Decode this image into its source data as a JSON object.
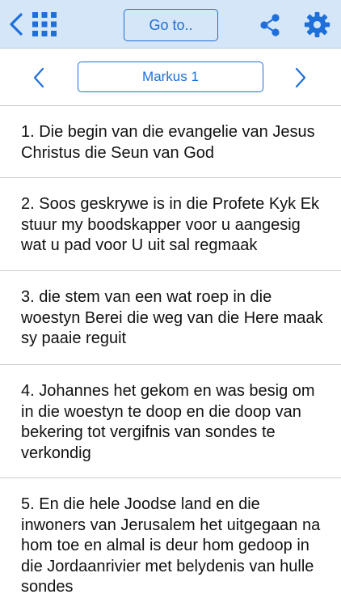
{
  "toolbar": {
    "goto_label": "Go to..",
    "back_icon": "chevron-left-icon",
    "grid_icon": "grid-icon",
    "share_icon": "share-icon",
    "settings_icon": "gear-icon"
  },
  "nav": {
    "chapter_label": "Markus 1",
    "prev_icon": "chevron-left-icon",
    "next_icon": "chevron-right-icon"
  },
  "colors": {
    "accent": "#1e6fd9",
    "toolbar_bg": "#d4e6f7",
    "separator": "#cfcfcf"
  },
  "verses": [
    {
      "text": "1. Die begin van die evangelie van Jesus Christus  die Seun van God"
    },
    {
      "text": "2. Soos geskrywe is in die Profete Kyk  Ek stuur my boodskapper voor u aangesig  wat u pad voor U uit sal regmaak"
    },
    {
      "text": "3. die stem van een wat roep in die woestyn  Berei die weg van die Here maak sy paaie reguit"
    },
    {
      "text": "4. Johannes het gekom en was besig om in die woestyn te doop en die doop van bekering tot vergifnis van sondes te verkondig"
    },
    {
      "text": "5. En die hele Joodse land en die inwoners van Jerusalem het uitgegaan na hom toe  en almal is deur hom gedoop in die Jordaanrivier met belydenis van hulle sondes"
    }
  ]
}
